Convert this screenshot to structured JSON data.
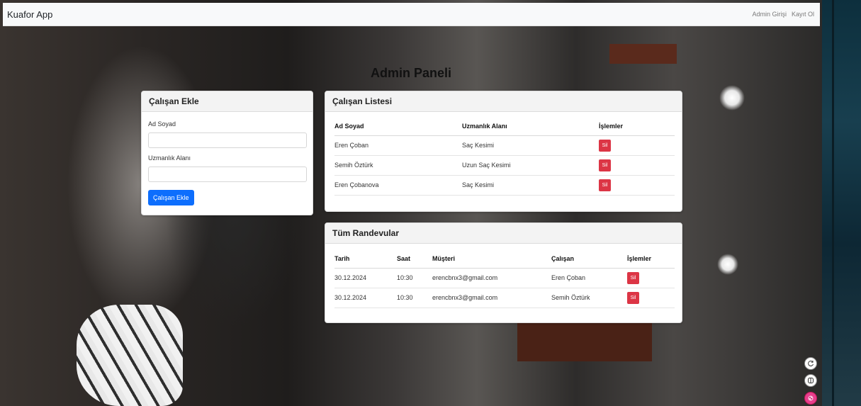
{
  "navbar": {
    "brand": "Kuafor App",
    "links": [
      "Admin Girişi",
      "Kayıt Ol"
    ]
  },
  "page_title": "Admin Paneli",
  "employee_form": {
    "title": "Çalışan Ekle",
    "name_label": "Ad Soyad",
    "name_value": "",
    "specialty_label": "Uzmanlık Alanı",
    "specialty_value": "",
    "submit_label": "Çalışan Ekle"
  },
  "employee_list": {
    "title": "Çalışan Listesi",
    "headers": [
      "Ad Soyad",
      "Uzmanlık Alanı",
      "İşlemler"
    ],
    "rows": [
      {
        "name": "Eren Çoban",
        "specialty": "Saç Kesimi",
        "action": "Sil"
      },
      {
        "name": "Semih Öztürk",
        "specialty": "Uzun Saç Kesimi",
        "action": "Sil"
      },
      {
        "name": "Eren Çobanova",
        "specialty": "Saç Kesimi",
        "action": "Sil"
      }
    ]
  },
  "appointments": {
    "title": "Tüm Randevular",
    "headers": [
      "Tarih",
      "Saat",
      "Müşteri",
      "Çalışan",
      "İşlemler"
    ],
    "rows": [
      {
        "date": "30.12.2024",
        "time": "10:30",
        "customer": "erencbnx3@gmail.com",
        "employee": "Eren Çoban",
        "action": "Sil"
      },
      {
        "date": "30.12.2024",
        "time": "10:30",
        "customer": "erencbnx3@gmail.com",
        "employee": "Semih Öztürk",
        "action": "Sil"
      }
    ]
  },
  "colors": {
    "primary": "#0d6efd",
    "danger": "#dc3545",
    "navbar_bg": "#f8f9fa"
  },
  "floating_icons": [
    "refresh-icon",
    "panel-icon",
    "color-palette-icon"
  ]
}
